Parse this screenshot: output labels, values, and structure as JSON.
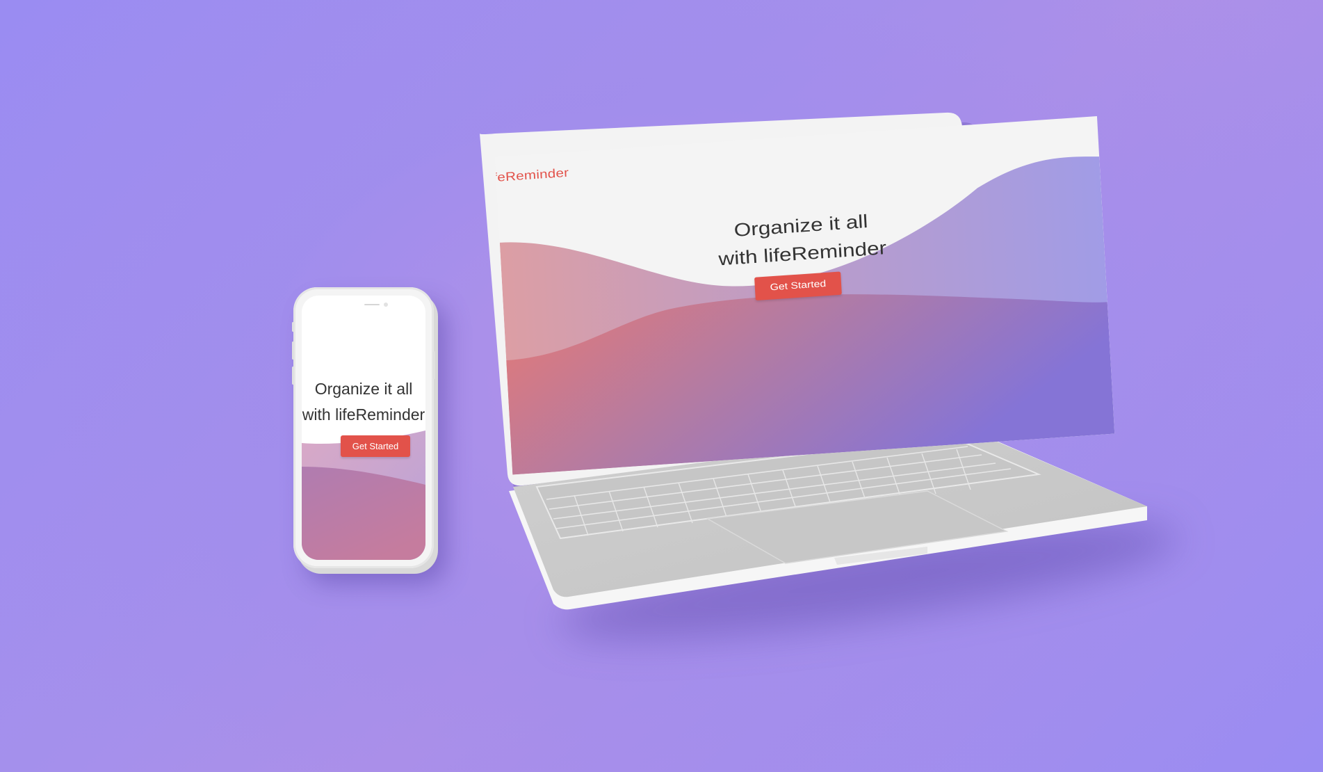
{
  "scene": {
    "background_colors": [
      "#9a8cf2",
      "#ad90e8"
    ],
    "accent_color": "#e2524a",
    "wave_colors": [
      "#e57670",
      "#c4849f",
      "#8a74d6"
    ]
  },
  "phone": {
    "headline_line1": "Organize it all",
    "headline_line2": "with lifeReminder",
    "cta_label": "Get Started"
  },
  "laptop": {
    "brand_text": "lifeReminder",
    "headline_line1": "Organize it all",
    "headline_line2": "with lifeReminder",
    "cta_label": "Get Started"
  }
}
